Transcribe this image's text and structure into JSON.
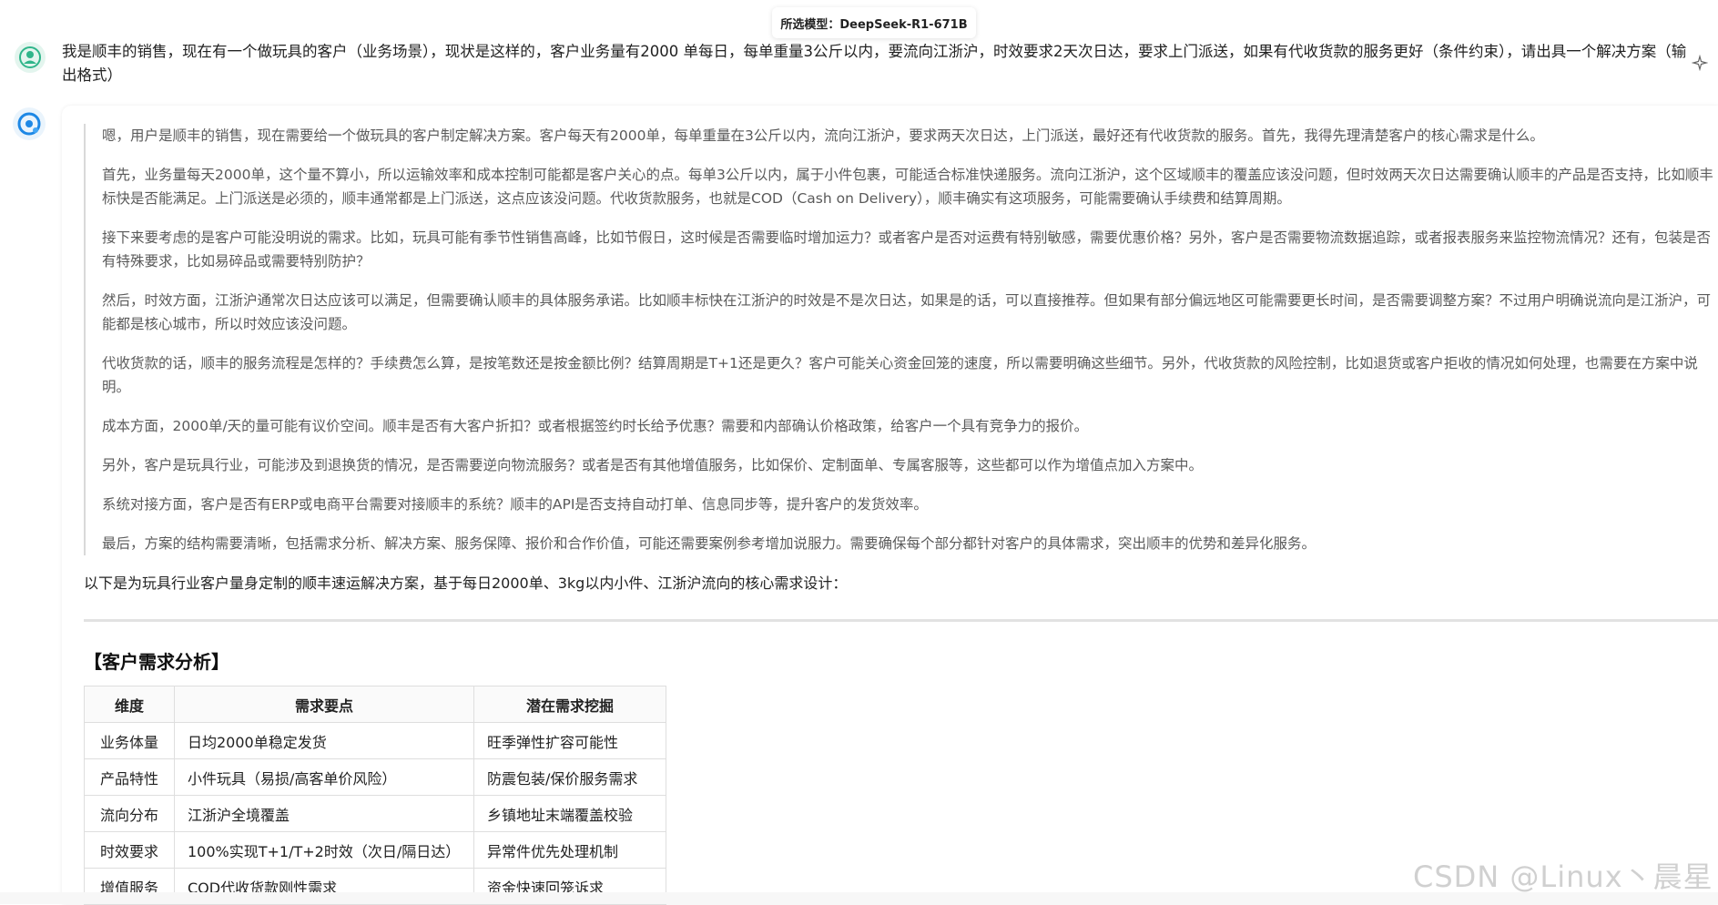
{
  "header": {
    "model_label": "所选模型：DeepSeek-R1-671B"
  },
  "user": {
    "avatar_icon": "user-avatar-icon",
    "message": "我是顺丰的销售，现在有一个做玩具的客户（业务场景），现状是这样的，客户业务量有2000 单每日，每单重量3公斤以内，要流向江浙沪，时效要求2天次日达，要求上门派送，如果有代收货款的服务更好（条件约束），请出具一个解决方案（输出格式）",
    "action_icon": "sparkle-icon"
  },
  "assistant": {
    "avatar_icon": "deepseek-logo-icon",
    "thinking": [
      "嗯，用户是顺丰的销售，现在需要给一个做玩具的客户制定解决方案。客户每天有2000单，每单重量在3公斤以内，流向江浙沪，要求两天次日达，上门派送，最好还有代收货款的服务。首先，我得先理清楚客户的核心需求是什么。",
      "首先，业务量每天2000单，这个量不算小，所以运输效率和成本控制可能都是客户关心的点。每单3公斤以内，属于小件包裹，可能适合标准快递服务。流向江浙沪，这个区域顺丰的覆盖应该没问题，但时效两天次日达需要确认顺丰的产品是否支持，比如顺丰标快是否能满足。上门派送是必须的，顺丰通常都是上门派送，这点应该没问题。代收货款服务，也就是COD（Cash on Delivery），顺丰确实有这项服务，可能需要确认手续费和结算周期。",
      "接下来要考虑的是客户可能没明说的需求。比如，玩具可能有季节性销售高峰，比如节假日，这时候是否需要临时增加运力？或者客户是否对运费有特别敏感，需要优惠价格？另外，客户是否需要物流数据追踪，或者报表服务来监控物流情况？还有，包装是否有特殊要求，比如易碎品或需要特别防护？",
      "然后，时效方面，江浙沪通常次日达应该可以满足，但需要确认顺丰的具体服务承诺。比如顺丰标快在江浙沪的时效是不是次日达，如果是的话，可以直接推荐。但如果有部分偏远地区可能需要更长时间，是否需要调整方案？不过用户明确说流向是江浙沪，可能都是核心城市，所以时效应该没问题。",
      "代收货款的话，顺丰的服务流程是怎样的？手续费怎么算，是按笔数还是按金额比例？结算周期是T+1还是更久？客户可能关心资金回笼的速度，所以需要明确这些细节。另外，代收货款的风险控制，比如退货或客户拒收的情况如何处理，也需要在方案中说明。",
      "成本方面，2000单/天的量可能有议价空间。顺丰是否有大客户折扣？或者根据签约时长给予优惠？需要和内部确认价格政策，给客户一个具有竞争力的报价。",
      "另外，客户是玩具行业，可能涉及到退换货的情况，是否需要逆向物流服务？或者是否有其他增值服务，比如保价、定制面单、专属客服等，这些都可以作为增值点加入方案中。",
      "系统对接方面，客户是否有ERP或电商平台需要对接顺丰的系统？顺丰的API是否支持自动打单、信息同步等，提升客户的发货效率。",
      "最后，方案的结构需要清晰，包括需求分析、解决方案、服务保障、报价和合作价值，可能还需要案例参考增加说服力。需要确保每个部分都针对客户的具体需求，突出顺丰的优势和差异化服务。"
    ],
    "intro": "以下是为玩具行业客户量身定制的顺丰速运解决方案，基于每日2000单、3kg以内小件、江浙沪流向的核心需求设计：",
    "section_title": "【客户需求分析】",
    "table": {
      "headers": [
        "维度",
        "需求要点",
        "潜在需求挖掘"
      ],
      "rows": [
        [
          "业务体量",
          "日均2000单稳定发货",
          "旺季弹性扩容可能性"
        ],
        [
          "产品特性",
          "小件玩具（易损/高客单价风险）",
          "防震包装/保价服务需求"
        ],
        [
          "流向分布",
          "江浙沪全境覆盖",
          "乡镇地址末端覆盖校验"
        ],
        [
          "时效要求",
          "100%实现T+1/T+2时效（次日/隔日达）",
          "异常件优先处理机制"
        ],
        [
          "增值服务",
          "COD代收货款刚性需求",
          "资金快速回笼诉求"
        ]
      ]
    }
  },
  "watermark": "CSDN @Linux丶晨星"
}
